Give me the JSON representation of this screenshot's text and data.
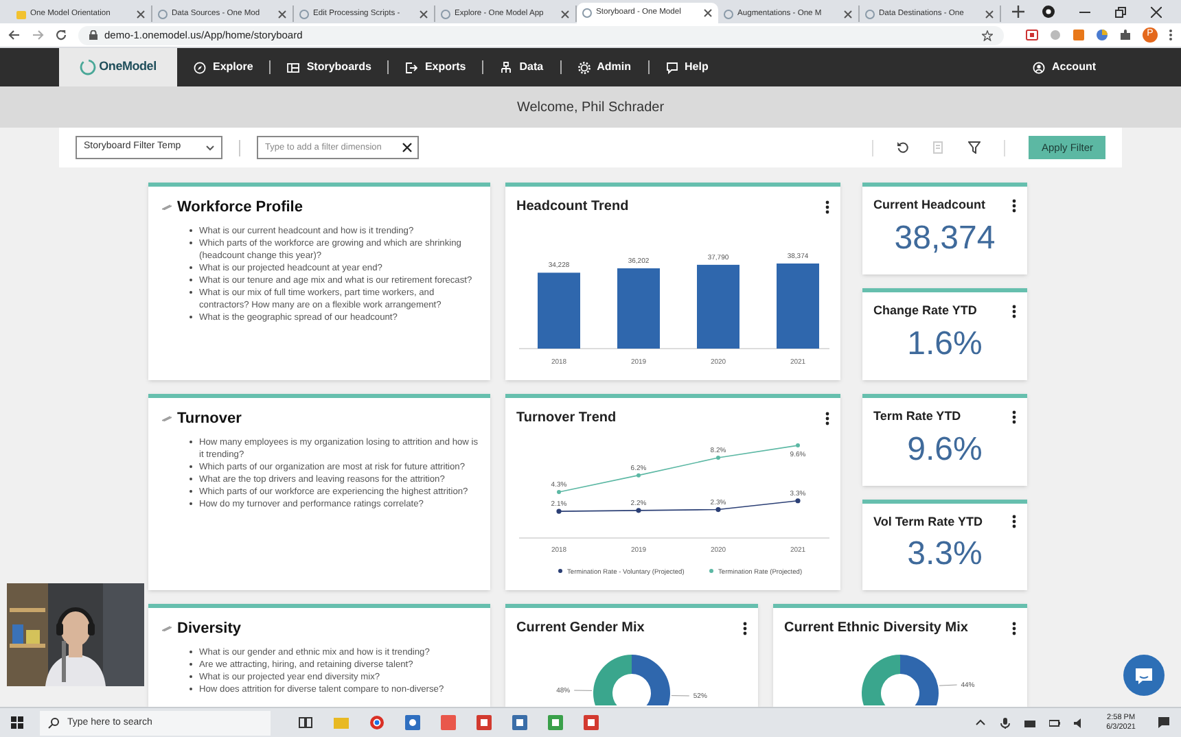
{
  "browser": {
    "tabs": [
      {
        "title": "One Model Orientation",
        "selected": false
      },
      {
        "title": "Data Sources - One Mod",
        "selected": false
      },
      {
        "title": "Edit Processing Scripts -",
        "selected": false
      },
      {
        "title": "Explore - One Model App",
        "selected": false
      },
      {
        "title": "Storyboard - One Model",
        "selected": true
      },
      {
        "title": "Augmentations - One M",
        "selected": false
      },
      {
        "title": "Data Destinations - One",
        "selected": false
      }
    ],
    "address": "demo-1.onemodel.us/App/home/storyboard",
    "profile_initial": "P"
  },
  "nav": {
    "logo": "OneModel",
    "items": [
      "Explore",
      "Storyboards",
      "Exports",
      "Data",
      "Admin",
      "Help"
    ],
    "account": "Account"
  },
  "welcome": "Welcome, Phil Schrader",
  "filter": {
    "template": "Storyboard Filter Temp",
    "placeholder": "Type to add a filter dimension",
    "apply": "Apply Filter"
  },
  "rows": [
    {
      "cards": [
        {
          "kind": "questions",
          "title": "Workforce Profile",
          "items": [
            "What is our current headcount and how is it trending?",
            "Which parts of the workforce are growing and which are shrinking (headcount change this year)?",
            "What is our projected headcount at year end?",
            "What is our tenure and age mix and what is our retirement forecast?",
            "What is our mix of full time workers, part time workers, and contractors? How many are on a flexible work arrangement?",
            "What is the geographic spread of our headcount?"
          ]
        },
        {
          "kind": "chart",
          "title": "Headcount Trend",
          "chart_data": {
            "type": "bar",
            "categories": [
              "2018",
              "2019",
              "2020",
              "2021"
            ],
            "values": [
              34228,
              36202,
              37790,
              38374
            ],
            "value_labels": [
              "34,228",
              "36,202",
              "37,790",
              "38,374"
            ]
          }
        },
        {
          "kind": "metrics",
          "items": [
            {
              "title": "Current Headcount",
              "value": "38,374"
            },
            {
              "title": "Change Rate YTD",
              "value": "1.6%"
            }
          ]
        }
      ]
    },
    {
      "cards": [
        {
          "kind": "questions",
          "title": "Turnover",
          "items": [
            "How many employees is my organization losing to attrition and how is it trending?",
            "Which parts of our organization are most at risk for future attrition?",
            "What are the top drivers and leaving reasons for the attrition?",
            "Which parts of our workforce are experiencing the highest attrition?",
            "How do my turnover and performance ratings correlate?"
          ]
        },
        {
          "kind": "chart",
          "title": "Turnover Trend",
          "chart_data": {
            "type": "line",
            "legend": "bottom",
            "categories": [
              "2018",
              "2019",
              "2020",
              "2021"
            ],
            "series": [
              {
                "name": "Termination Rate - Voluntary (Projected)",
                "color": "#2b3f75",
                "marker": "circle",
                "values": [
                  2.1,
                  2.2,
                  2.3,
                  3.3
                ],
                "value_labels": [
                  "2.1%",
                  "2.2%",
                  "2.3%",
                  "3.3%"
                ]
              },
              {
                "name": "Termination Rate (Projected)",
                "color": "#5cb8a4",
                "marker": "circle",
                "values": [
                  4.3,
                  6.2,
                  8.2,
                  9.6
                ],
                "value_labels": [
                  "4.3%",
                  "6.2%",
                  "8.2%",
                  "9.6%"
                ]
              }
            ]
          }
        },
        {
          "kind": "metrics",
          "items": [
            {
              "title": "Term Rate YTD",
              "value": "9.6%"
            },
            {
              "title": "Vol Term Rate YTD",
              "value": "3.3%"
            }
          ]
        }
      ]
    },
    {
      "cards": [
        {
          "kind": "questions",
          "title": "Diversity",
          "items": [
            "What is our gender and ethnic mix and how is it trending?",
            "Are we attracting, hiring, and retaining diverse talent?",
            "What is our projected year end diversity mix?",
            "How does attrition for diverse talent compare to non-diverse?"
          ]
        },
        {
          "kind": "donut",
          "title": "Current Gender Mix",
          "chart_data": {
            "type": "donut",
            "values": [
              52,
              48
            ],
            "value_labels": [
              "52%",
              "48%"
            ]
          }
        },
        {
          "kind": "donut",
          "title": "Current Ethnic Diversity Mix",
          "chart_data": {
            "type": "donut",
            "values": [
              44,
              56
            ],
            "value_labels": [
              "44%",
              null
            ]
          }
        }
      ]
    }
  ],
  "taskbar": {
    "search_placeholder": "Type here to search",
    "time": "2:58 PM",
    "date": "6/3/2021"
  }
}
